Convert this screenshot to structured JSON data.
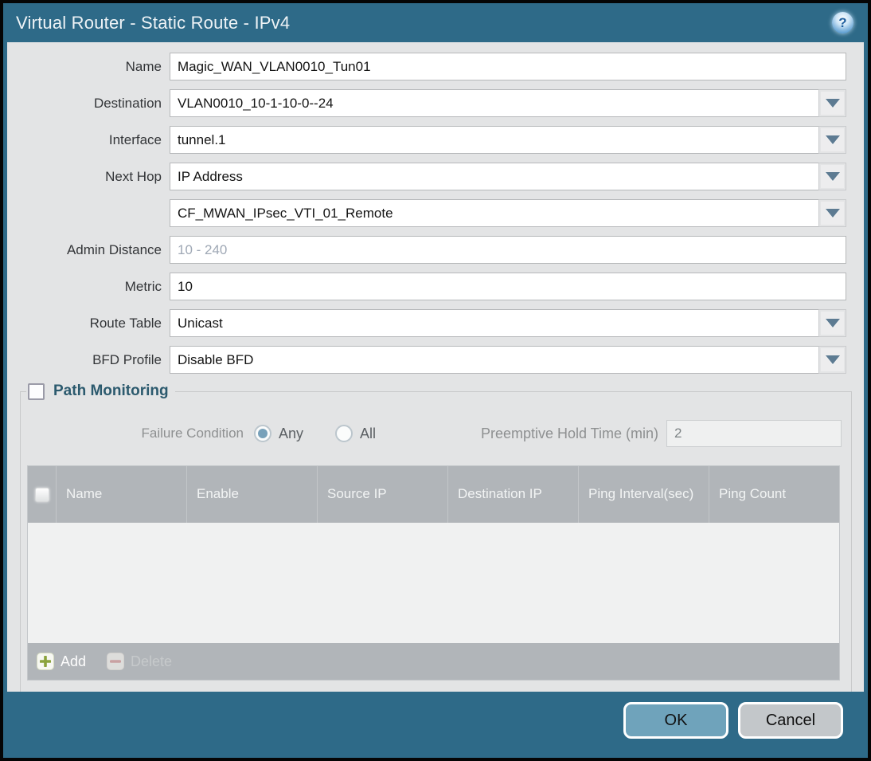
{
  "dialog": {
    "title": "Virtual Router - Static Route - IPv4",
    "help_icon": "help-icon",
    "help_glyph": "?"
  },
  "form": {
    "fields": [
      {
        "label": "Name",
        "value": "Magic_WAN_VLAN0010_Tun01",
        "type": "text"
      },
      {
        "label": "Destination",
        "value": "VLAN0010_10-1-10-0--24",
        "type": "dropdown"
      },
      {
        "label": "Interface",
        "value": "tunnel.1",
        "type": "dropdown"
      },
      {
        "label": "Next Hop",
        "value": "IP Address",
        "type": "dropdown"
      },
      {
        "label": "",
        "value": "CF_MWAN_IPsec_VTI_01_Remote",
        "type": "dropdown"
      },
      {
        "label": "Admin Distance",
        "value": "",
        "placeholder": "10 - 240",
        "type": "text"
      },
      {
        "label": "Metric",
        "value": "10",
        "type": "text"
      },
      {
        "label": "Route Table",
        "value": "Unicast",
        "type": "dropdown"
      },
      {
        "label": "BFD Profile",
        "value": "Disable BFD",
        "type": "dropdown"
      }
    ]
  },
  "path_monitoring": {
    "legend": "Path Monitoring",
    "checkbox_checked": false,
    "failure_condition_label": "Failure Condition",
    "options": [
      "Any",
      "All"
    ],
    "selected_option": "Any",
    "preemptive_label": "Preemptive Hold Time (min)",
    "preemptive_value": "2",
    "preemptive_disabled": true,
    "table": {
      "columns": [
        "Name",
        "Enable",
        "Source IP",
        "Destination IP",
        "Ping Interval(sec)",
        "Ping Count"
      ],
      "rows": [],
      "add_label": "Add",
      "delete_label": "Delete",
      "delete_disabled": true
    }
  },
  "footer": {
    "ok_label": "OK",
    "cancel_label": "Cancel"
  },
  "colors": {
    "titlebar_teal": "#2e6a88",
    "content_bg": "#e3e4e5",
    "legend_teal": "#2c5a6e",
    "table_header_gray": "#b1b5b9",
    "ok_button": "#6fa3bb",
    "cancel_button": "#c3c7ca",
    "add_icon_green": "#8ba33c",
    "delete_icon_red": "#cf9d9d",
    "radio_selected_fill": "#78a1ba",
    "dropdown_arrow": "#5d7b92"
  }
}
